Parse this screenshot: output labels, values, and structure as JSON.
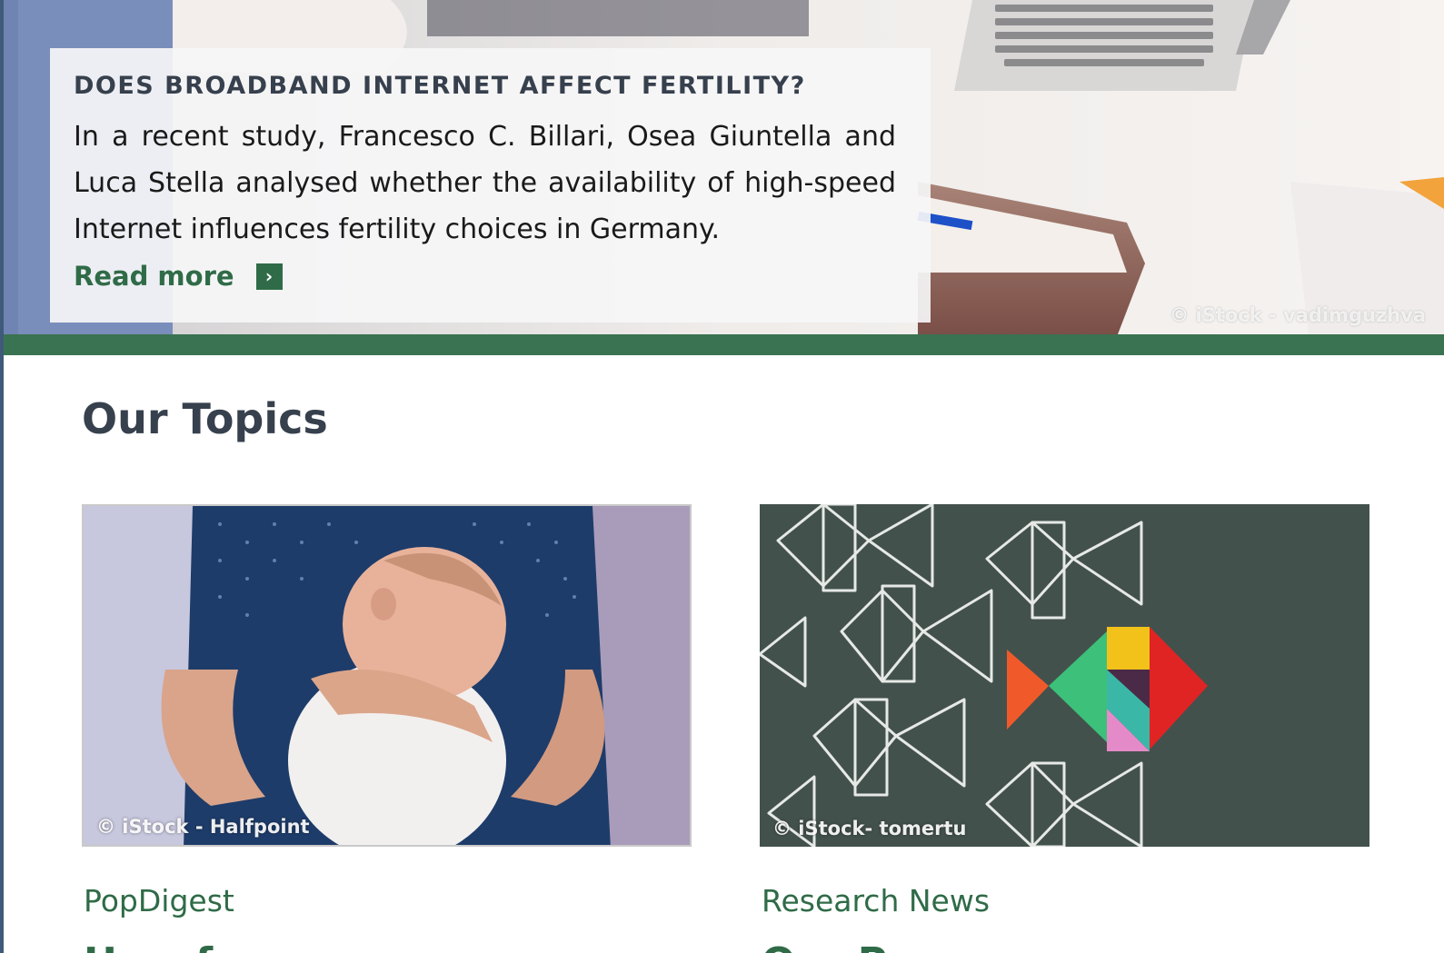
{
  "hero": {
    "title": "DOES BROADBAND INTERNET AFFECT FERTILITY?",
    "text": "In a recent study, Francesco C. Billari, Osea Giuntella and Luca Stella analysed whether the availability of high-speed Internet influences fertility choices in Germany.",
    "read_more_label": "Read more",
    "read_more_icon": "chevron-right-icon",
    "image_credit": "© iStock - vadimguzhva"
  },
  "topics": {
    "title": "Our Topics",
    "cards": [
      {
        "image_credit": "© iStock - Halfpoint",
        "category": "PopDigest",
        "heading": "How fe... "
      },
      {
        "image_credit": "© iStock- tomertu",
        "category": "Research News",
        "heading": "Our Pe... "
      }
    ]
  },
  "colors": {
    "accent_green": "#3a7351",
    "text_green": "#2f6b47",
    "heading_dark": "#37404d",
    "left_rule": "#3f5a7a"
  }
}
